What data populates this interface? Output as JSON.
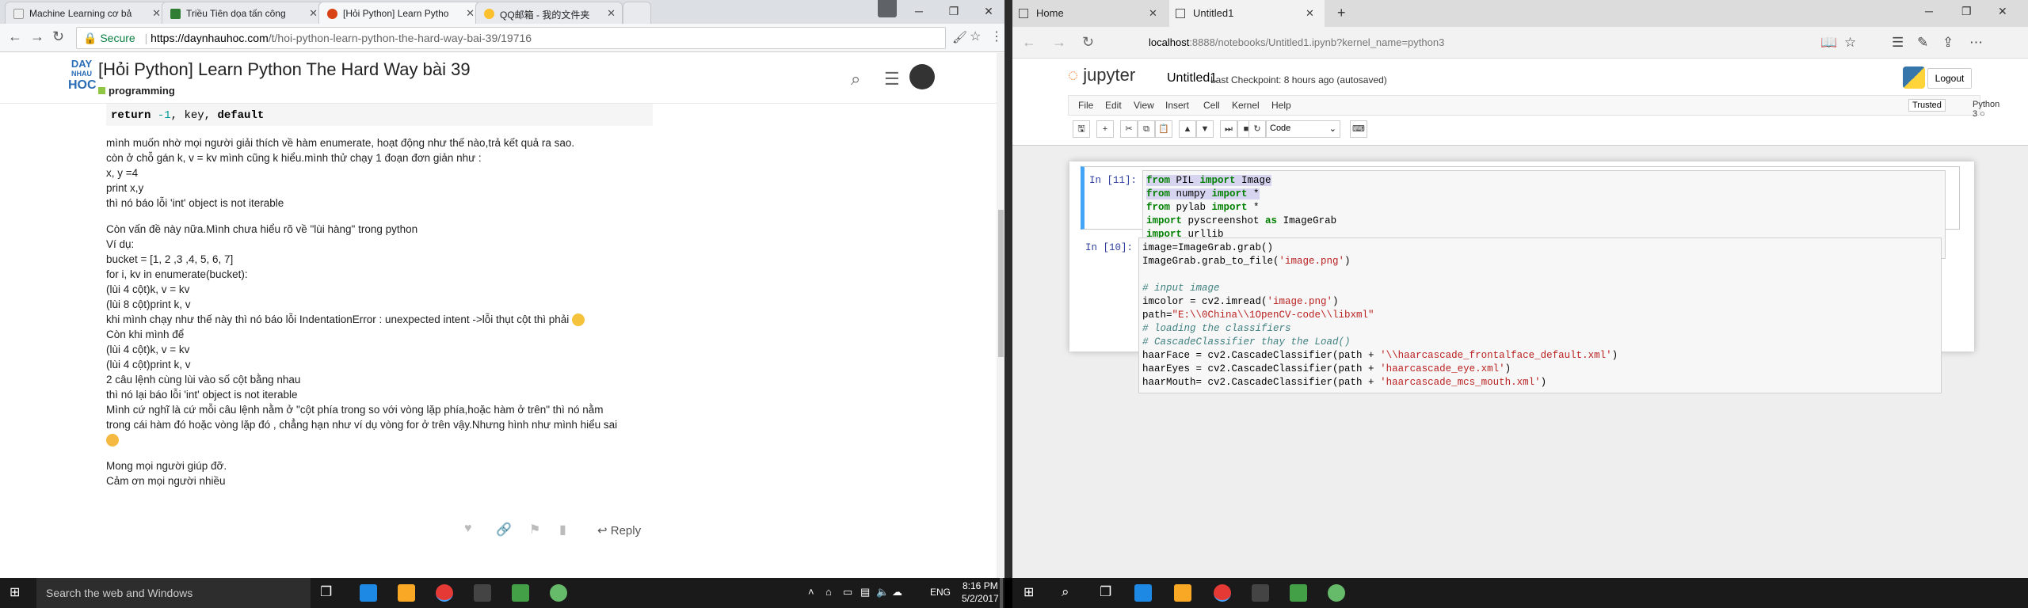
{
  "left_browser": {
    "tabs": [
      {
        "title": "Machine Learning cơ bả",
        "favicon_color": "#e8e8e8"
      },
      {
        "title": "Triều Tiên dọa tấn công",
        "favicon_color": "#2e7d32"
      },
      {
        "title": "[Hỏi Python] Learn Pytho",
        "favicon_color": "#d84315"
      },
      {
        "title": "QQ邮箱 - 我的文件夹",
        "favicon_color": "#fbc02d"
      }
    ],
    "secure_label": "Secure",
    "url_host": "https://daynhauhoc.com",
    "url_path": "/t/hoi-python-learn-python-the-hard-way-bai-39/19716"
  },
  "site": {
    "logo_lines": [
      "DAY",
      "NHAU",
      "HOC"
    ],
    "title": "[Hỏi Python] Learn Python The Hard Way bài 39",
    "category": "programming",
    "code_line": {
      "kw": "return",
      "neg": "-1",
      "rest1": ", key, ",
      "kw2": "default"
    },
    "post_lines": [
      "mình muốn nhờ mọi người giải thích về hàm enumerate, hoạt động như thế nào,trả kết quả ra sao.",
      "còn ở chỗ gán k, v = kv mình cũng k hiểu.mình thử chạy 1 đoạn đơn giản như :",
      "x, y =4",
      "print x,y",
      "thì nó báo lỗi 'int' object is not iterable",
      "",
      "Còn vấn đề này nữa.Mình chưa hiểu rõ về \"lùi hàng\" trong python",
      "Ví dụ:",
      "bucket = [1, 2 ,3 ,4, 5, 6, 7]",
      "for i, kv in enumerate(bucket):",
      "(lùi 4 cột)k, v = kv",
      "(lùi 8 cột)print k, v",
      "khi mình chạy như thế này thì nó báo lỗi IndentationError : unexpected intent ->lỗi thụt cột thì phải",
      "Còn khi mình để",
      "(lùi 4 cột)k, v = kv",
      "(lùi 4 cột)print k, v",
      "2 câu lệnh cùng lùi vào số cột bằng nhau",
      "thì nó lại báo lỗi 'int' object is not iterable",
      "Mình cứ nghĩ là cứ mỗi câu lệnh nằm ở \"cột phía trong so với vòng lặp phía,hoặc hàm ở trên\" thì nó nằm",
      "trong cái hàm đó hoặc vòng lặp đó , chẳng hạn như ví dụ vòng for ở trên vậy.Nhưng hình như mình hiểu sai",
      "",
      "",
      "Mong mọi người giúp đỡ.",
      "Cảm ơn mọi người nhiều"
    ],
    "reply_label": "Reply"
  },
  "right_browser": {
    "tabs": [
      {
        "title": "Home"
      },
      {
        "title": "Untitled1"
      }
    ],
    "url_host": "localhost",
    "url_rest": ":8888/notebooks/Untitled1.ipynb?kernel_name=python3"
  },
  "jupyter": {
    "logo_text": "jupyter",
    "notebook_name": "Untitled1",
    "checkpoint": "Last Checkpoint: 8 hours ago (autosaved)",
    "logout": "Logout",
    "menu": [
      "File",
      "Edit",
      "View",
      "Insert",
      "Cell",
      "Kernel",
      "Help"
    ],
    "trusted": "Trusted",
    "kernel": "Python 3",
    "cell_type": "Code",
    "cells": [
      {
        "prompt": "In [11]:"
      },
      {
        "prompt": "In [10]:"
      }
    ]
  },
  "taskbar": {
    "search_placeholder": "Search the web and Windows",
    "lang": "ENG",
    "time": "8:16 PM",
    "date": "5/2/2017"
  }
}
